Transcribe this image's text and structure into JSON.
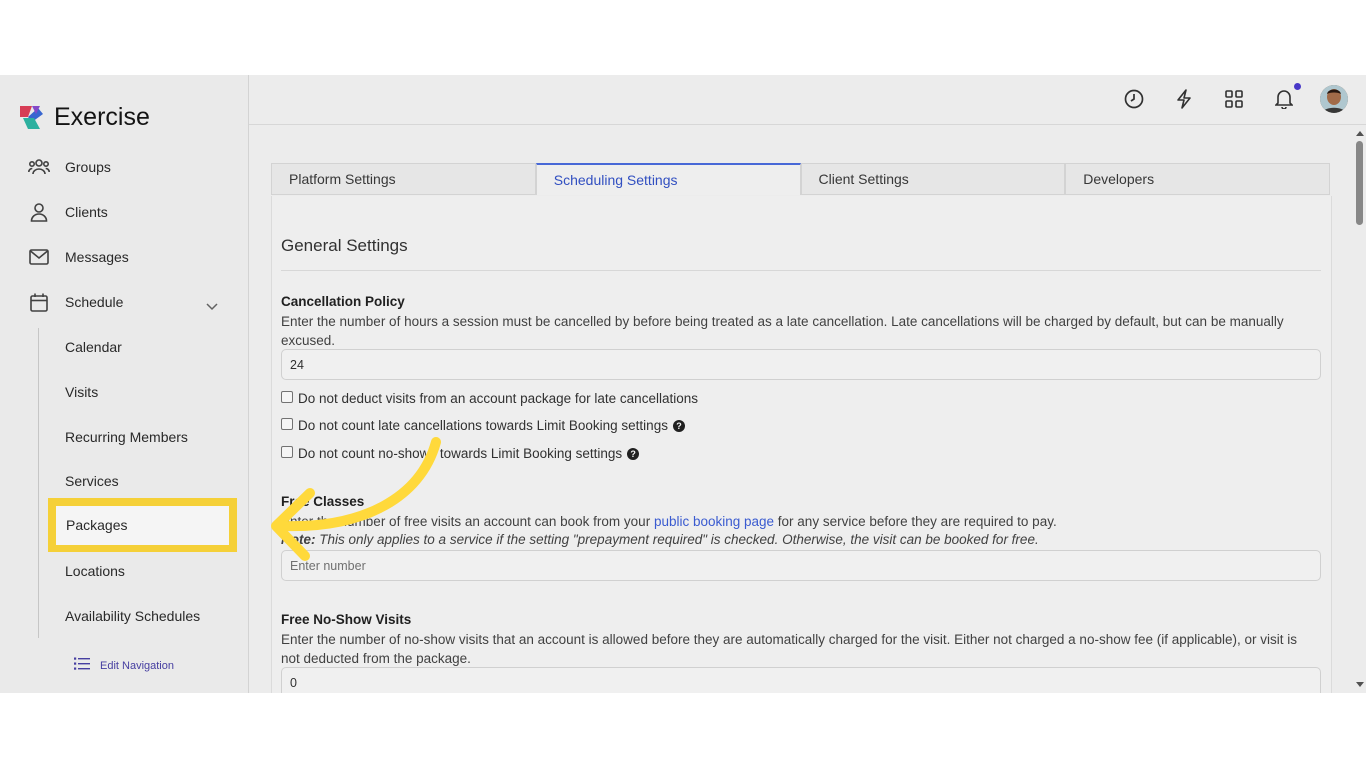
{
  "app": {
    "name": "Exercise"
  },
  "sidebar": {
    "items": [
      {
        "label": "Groups",
        "icon": "groups-icon"
      },
      {
        "label": "Clients",
        "icon": "person-icon"
      },
      {
        "label": "Messages",
        "icon": "envelope-icon"
      },
      {
        "label": "Schedule",
        "icon": "calendar-icon"
      }
    ],
    "schedule_sub": [
      "Calendar",
      "Visits",
      "Recurring Members",
      "Services",
      "Packages",
      "Locations",
      "Availability Schedules"
    ],
    "edit_navigation": "Edit Navigation"
  },
  "topbar": {
    "icons": [
      "clock-icon",
      "lightning-icon",
      "apps-grid-icon",
      "bell-icon",
      "avatar"
    ]
  },
  "tabs": [
    "Platform Settings",
    "Scheduling Settings",
    "Client Settings",
    "Developers"
  ],
  "active_tab": "Scheduling Settings",
  "settings": {
    "section_title": "General Settings",
    "cancellation": {
      "label": "Cancellation Policy",
      "desc": "Enter the number of hours a session must be cancelled by before being treated as a late cancellation. Late cancellations will be charged by default, but can be manually excused.",
      "value": "24",
      "checkbox1": "Do not deduct visits from an account package for late cancellations",
      "checkbox2": "Do not count late cancellations towards Limit Booking settings",
      "checkbox3": "Do not count no-shows towards Limit Booking settings"
    },
    "free_classes": {
      "label": "Free Classes",
      "desc_before": "Enter the number of free visits an account can book from your ",
      "desc_link": "public booking page",
      "desc_after": " for any service before they are required to pay.",
      "note_label": "Note:",
      "note_text": " This only applies to a service if the setting \"prepayment required\" is checked. Otherwise, the visit can be booked for free.",
      "placeholder": "Enter number"
    },
    "free_noshow": {
      "label": "Free No-Show Visits",
      "desc": "Enter the number of no-show visits that an account is allowed before they are automatically charged for the visit. Either not charged a no-show fee (if applicable), or visit is not deducted from the package.",
      "value": "0"
    }
  },
  "colors": {
    "highlight": "#ffd93b",
    "accent": "#3453c9",
    "brand_text": "#4a42a8"
  }
}
